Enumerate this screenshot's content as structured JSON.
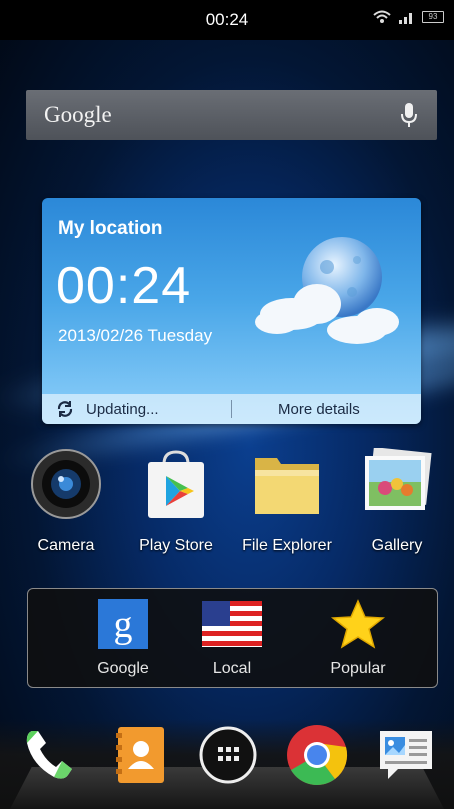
{
  "status_bar": {
    "time": "00:24",
    "battery": "93"
  },
  "search_widget": {
    "brand": "Google"
  },
  "weather_widget": {
    "location": "My location",
    "time": "00:24",
    "date": "2013/02/26  Tuesday",
    "status": "Updating...",
    "details": "More details"
  },
  "apps": [
    {
      "label": "Camera",
      "icon": "camera-icon"
    },
    {
      "label": "Play Store",
      "icon": "play-store-icon"
    },
    {
      "label": "File Explorer",
      "icon": "folder-icon"
    },
    {
      "label": "Gallery",
      "icon": "gallery-icon"
    }
  ],
  "folder": {
    "items": [
      {
        "label": "Google",
        "icon": "google-icon"
      },
      {
        "label": "Local",
        "icon": "us-flag-icon"
      },
      {
        "label": "Popular",
        "icon": "star-icon"
      }
    ]
  },
  "dock": {
    "items": [
      "phone-icon",
      "contacts-icon",
      "app-drawer-icon",
      "chrome-icon",
      "messaging-icon"
    ]
  },
  "colors": {
    "weather_top": "#2b88d8",
    "folder_bg": "#0f0f0f",
    "accent_star": "#ffd21a"
  }
}
